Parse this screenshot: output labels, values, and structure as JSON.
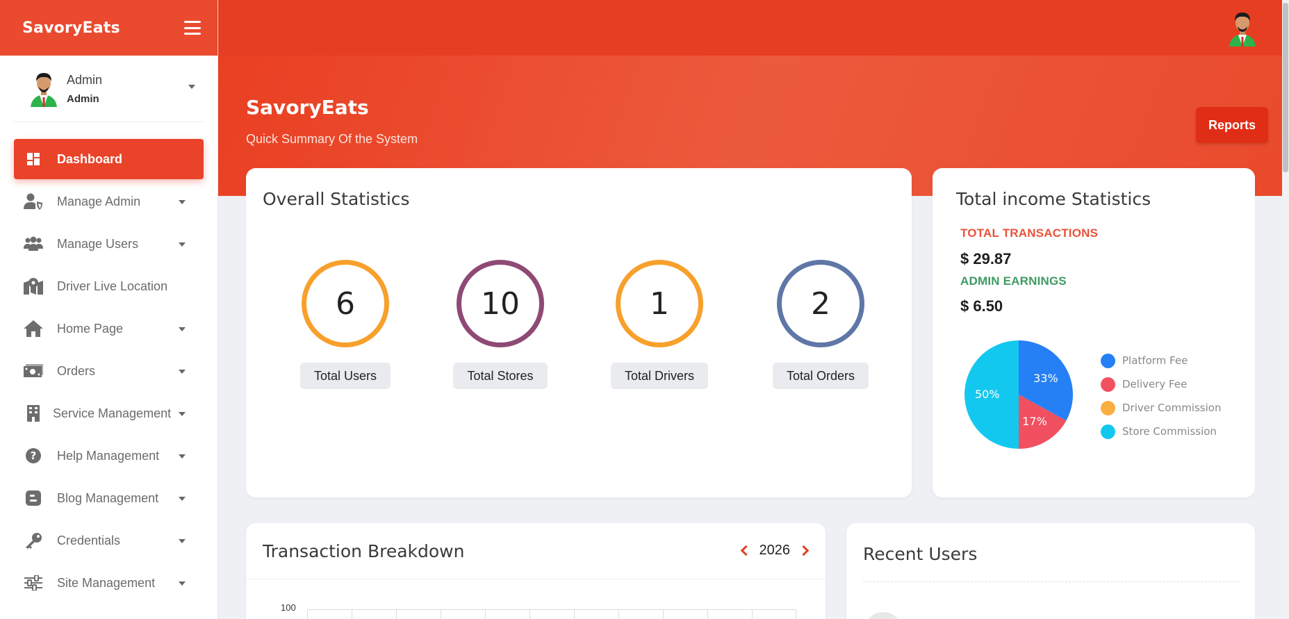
{
  "brand": {
    "name": "SavoryEats"
  },
  "profile": {
    "name": "Admin",
    "role": "Admin"
  },
  "menu": [
    {
      "label": "Dashboard",
      "icon": "dashboard-icon",
      "active": true,
      "dropdown": false
    },
    {
      "label": "Manage Admin",
      "icon": "user-shield-icon",
      "dropdown": true
    },
    {
      "label": "Manage Users",
      "icon": "users-icon",
      "dropdown": true
    },
    {
      "label": "Driver Live Location",
      "icon": "map-marker-icon",
      "dropdown": false
    },
    {
      "label": "Home Page",
      "icon": "home-icon",
      "dropdown": true
    },
    {
      "label": "Orders",
      "icon": "money-icon",
      "dropdown": true
    },
    {
      "label": "Service Management",
      "icon": "building-icon",
      "dropdown": true
    },
    {
      "label": "Help Management",
      "icon": "question-circle-icon",
      "dropdown": true
    },
    {
      "label": "Blog Management",
      "icon": "blogger-icon",
      "dropdown": true
    },
    {
      "label": "Credentials",
      "icon": "key-icon",
      "dropdown": true
    },
    {
      "label": "Site Management",
      "icon": "sliders-icon",
      "dropdown": true
    }
  ],
  "hero": {
    "title": "SavoryEats",
    "subtitle": "Quick Summary Of the System",
    "reports_label": "Reports"
  },
  "overall": {
    "title": "Overall Statistics",
    "stats": [
      {
        "value": "6",
        "label": "Total Users",
        "color": "#f7a02b"
      },
      {
        "value": "10",
        "label": "Total Stores",
        "color": "#8e4a74"
      },
      {
        "value": "1",
        "label": "Total Drivers",
        "color": "#f7a02b"
      },
      {
        "value": "2",
        "label": "Total Orders",
        "color": "#5f77a6"
      }
    ]
  },
  "income": {
    "title": "Total income Statistics",
    "transactions_label": "TOTAL TRANSACTIONS",
    "transactions_value": "$ 29.87",
    "earnings_label": "ADMIN EARNINGS",
    "earnings_value": "$ 6.50",
    "colors": {
      "transactions": "#e8533a",
      "earnings": "#3f9a63"
    }
  },
  "chart_data": {
    "type": "pie",
    "categories": [
      "Platform Fee",
      "Delivery Fee",
      "Driver Commission",
      "Store Commission"
    ],
    "values": [
      33,
      17,
      0,
      50
    ],
    "labels": [
      "33%",
      "17%",
      "",
      "50%"
    ],
    "colors": [
      "#2680f5",
      "#f0505f",
      "#fbae40",
      "#13c8ef"
    ],
    "legend": "right"
  },
  "transactions": {
    "title": "Transaction Breakdown",
    "year": "2026",
    "y_tick": "100"
  },
  "recent": {
    "title": "Recent Users"
  }
}
